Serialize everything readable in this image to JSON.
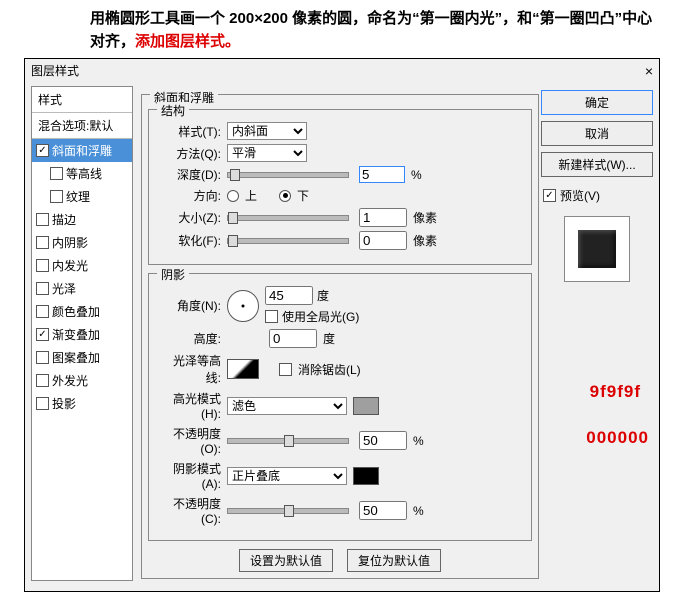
{
  "instruction": {
    "part1": "用椭圆形工具画一个 200×200 像素的圆，命名为“第一圈内光”，和“第一圈凹凸”中心对齐，",
    "part2": "添加图层样式。"
  },
  "dialog": {
    "title": "图层样式",
    "close": "×"
  },
  "left": {
    "hdr_styles": "样式",
    "hdr_blend": "混合选项:默认",
    "bevel": "斜面和浮雕",
    "contour": "等高线",
    "texture": "纹理",
    "stroke": "描边",
    "inner_shadow": "内阴影",
    "inner_glow": "内发光",
    "satin": "光泽",
    "color_overlay": "颜色叠加",
    "grad_overlay": "渐变叠加",
    "pattern_overlay": "图案叠加",
    "outer_glow": "外发光",
    "drop_shadow": "投影"
  },
  "panel": {
    "title": "斜面和浮雕",
    "structure": "结构",
    "shading": "阴影",
    "style_lbl": "样式(T):",
    "method_lbl": "方法(Q):",
    "depth_lbl": "深度(D):",
    "direction_lbl": "方向:",
    "size_lbl": "大小(Z):",
    "soften_lbl": "软化(F):",
    "angle_lbl": "角度(N):",
    "altitude_lbl": "高度:",
    "gloss_lbl": "光泽等高线:",
    "highlight_lbl": "高光模式(H):",
    "opacity_lbl1": "不透明度(O):",
    "shadow_lbl": "阴影模式(A):",
    "opacity_lbl2": "不透明度(C):",
    "style_opt": "内斜面",
    "method_opt": "平滑",
    "highlight_opt": "滤色",
    "shadow_opt": "正片叠底",
    "depth_val": "5",
    "size_val": "1",
    "soften_val": "0",
    "angle_val": "45",
    "altitude_val": "0",
    "opacity1_val": "50",
    "opacity2_val": "50",
    "dir_up": "上",
    "dir_down": "下",
    "global_light": "使用全局光(G)",
    "antialias": "消除锯齿(L)",
    "px": "像素",
    "pct": "%",
    "deg": "度",
    "ok_default": "设置为默认值",
    "reset_default": "复位为默认值"
  },
  "right": {
    "ok": "确定",
    "cancel": "取消",
    "new_style": "新建样式(W)...",
    "preview": "预览(V)"
  },
  "annot": {
    "hl_color": "9f9f9f",
    "sh_color": "000000"
  }
}
